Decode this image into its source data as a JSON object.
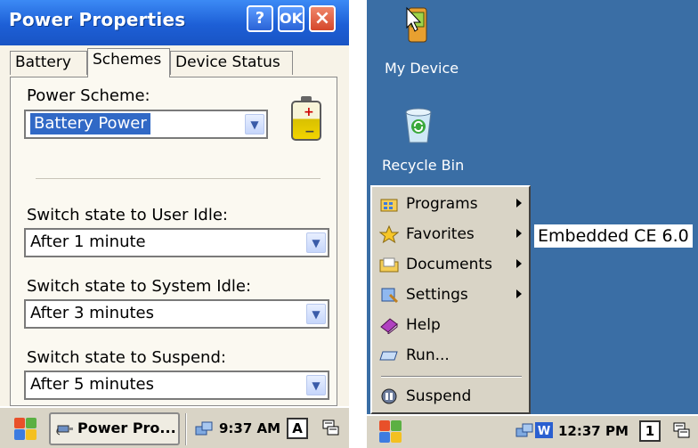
{
  "left": {
    "window_title": "Power Properties",
    "title_buttons": {
      "help": "?",
      "ok": "OK",
      "close": "×"
    },
    "tabs": [
      "Battery",
      "Schemes",
      "Device Status"
    ],
    "active_tab": "Schemes",
    "scheme_label": "Power Scheme:",
    "scheme_value": "Battery Power",
    "user_idle_label": "Switch state to User Idle:",
    "user_idle_value": "After 1 minute",
    "system_idle_label": "Switch state to System Idle:",
    "system_idle_value": "After 3 minutes",
    "suspend_label": "Switch state to Suspend:",
    "suspend_value": "After 5 minutes",
    "taskbar": {
      "task_label": "Power Pro...",
      "clock": "9:37 AM",
      "input_indicator": "A"
    }
  },
  "right": {
    "desktop_icons": [
      {
        "label": "My Device",
        "icon": "device-icon"
      },
      {
        "label": "Recycle Bin",
        "icon": "recycle-bin-icon"
      }
    ],
    "banner_text": "Embedded CE 6.0",
    "start_menu": {
      "items": [
        {
          "label": "Programs",
          "icon": "programs-icon",
          "submenu": true
        },
        {
          "label": "Favorites",
          "icon": "favorites-star-icon",
          "submenu": true
        },
        {
          "label": "Documents",
          "icon": "documents-folder-icon",
          "submenu": true
        },
        {
          "label": "Settings",
          "icon": "settings-icon",
          "submenu": true
        },
        {
          "label": "Help",
          "icon": "help-book-icon",
          "submenu": false
        },
        {
          "label": "Run...",
          "icon": "run-icon",
          "submenu": false
        },
        {
          "label": "Suspend",
          "icon": "suspend-icon",
          "submenu": false
        }
      ]
    },
    "taskbar": {
      "clock": "12:37 PM",
      "input_indicator": "1"
    }
  },
  "colors": {
    "titlebar": "#1d5fd6",
    "desktop": "#3a6ea5",
    "taskbar": "#d9d4c6",
    "selection": "#3169c6"
  }
}
